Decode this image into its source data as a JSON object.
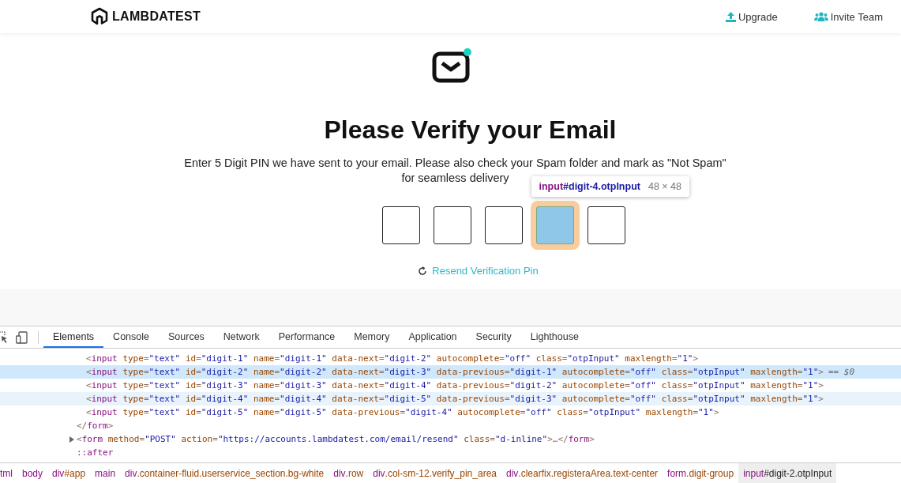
{
  "header": {
    "logo": "LAMBDATEST",
    "links": [
      {
        "label": "Upgrade",
        "kind": "upload"
      },
      {
        "label": "Invite Team",
        "kind": "users"
      }
    ]
  },
  "verify": {
    "title": "Please Verify your Email",
    "message": "Enter 5 Digit PIN we have sent to your email. Please also check your Spam folder and mark as \"Not Spam\" for seamless delivery",
    "pin_boxes": [
      {
        "highlighted": false
      },
      {
        "highlighted": false
      },
      {
        "highlighted": false
      },
      {
        "highlighted": true
      },
      {
        "highlighted": false
      }
    ],
    "tooltip": {
      "tag": "input",
      "selector": "#digit-4.otpInput",
      "size": "48 × 48"
    },
    "resend": "Resend Verification Pin"
  },
  "devtools": {
    "tabs": [
      {
        "label": "Elements",
        "selected": true
      },
      {
        "label": "Console",
        "selected": false
      },
      {
        "label": "Sources",
        "selected": false
      },
      {
        "label": "Network",
        "selected": false
      },
      {
        "label": "Performance",
        "selected": false
      },
      {
        "label": "Memory",
        "selected": false
      },
      {
        "label": "Application",
        "selected": false
      },
      {
        "label": "Security",
        "selected": false
      },
      {
        "label": "Lighthouse",
        "selected": false
      }
    ],
    "lines": [
      {
        "kind": "inner",
        "text": "<input type=\"text\" id=\"digit-1\" name=\"digit-1\" data-next=\"digit-2\" autocomplete=\"off\" class=\"otpInput\" maxlength=\"1\">",
        "selected": false,
        "hovered": false
      },
      {
        "kind": "inner",
        "text": "<input type=\"text\" id=\"digit-2\" name=\"digit-2\" data-next=\"digit-3\" data-previous=\"digit-1\" autocomplete=\"off\" class=\"otpInput\" maxlength=\"1\">",
        "suffix": "== $0",
        "selected": true,
        "hovered": false
      },
      {
        "kind": "inner",
        "text": "<input type=\"text\" id=\"digit-3\" name=\"digit-3\" data-next=\"digit-4\" data-previous=\"digit-2\" autocomplete=\"off\" class=\"otpInput\" maxlength=\"1\">",
        "selected": false,
        "hovered": false
      },
      {
        "kind": "inner",
        "text": "<input type=\"text\" id=\"digit-4\" name=\"digit-4\" data-next=\"digit-5\" data-previous=\"digit-3\" autocomplete=\"off\" class=\"otpInput\" maxlength=\"1\">",
        "selected": false,
        "hovered": true
      },
      {
        "kind": "inner",
        "text": "<input type=\"text\" id=\"digit-5\" name=\"digit-5\" data-previous=\"digit-4\" autocomplete=\"off\" class=\"otpInput\" maxlength=\"1\">",
        "selected": false,
        "hovered": false
      },
      {
        "kind": "outer",
        "text": "</form>",
        "selected": false,
        "hovered": false
      },
      {
        "kind": "collapsed",
        "text": "<form method=\"POST\" action=\"https://accounts.lambdatest.com/email/resend\" class=\"d-inline\">…</form>",
        "selected": false,
        "hovered": false
      },
      {
        "kind": "outer",
        "text": "::after",
        "selected": false,
        "hovered": false
      }
    ],
    "breadcrumbs": [
      {
        "label": "tml",
        "selected": false
      },
      {
        "label": "body",
        "selected": false
      },
      {
        "label": "div#app",
        "selected": false
      },
      {
        "label": "main",
        "selected": false
      },
      {
        "label": "div.container-fluid.userservice_section.bg-white",
        "selected": false
      },
      {
        "label": "div.row",
        "selected": false
      },
      {
        "label": "div.col-sm-12.verify_pin_area",
        "selected": false
      },
      {
        "label": "div.clearfix.registeraArea.text-center",
        "selected": false
      },
      {
        "label": "form.digit-group",
        "selected": false
      },
      {
        "label": "input#digit-2.otpInput",
        "selected": true
      }
    ]
  }
}
